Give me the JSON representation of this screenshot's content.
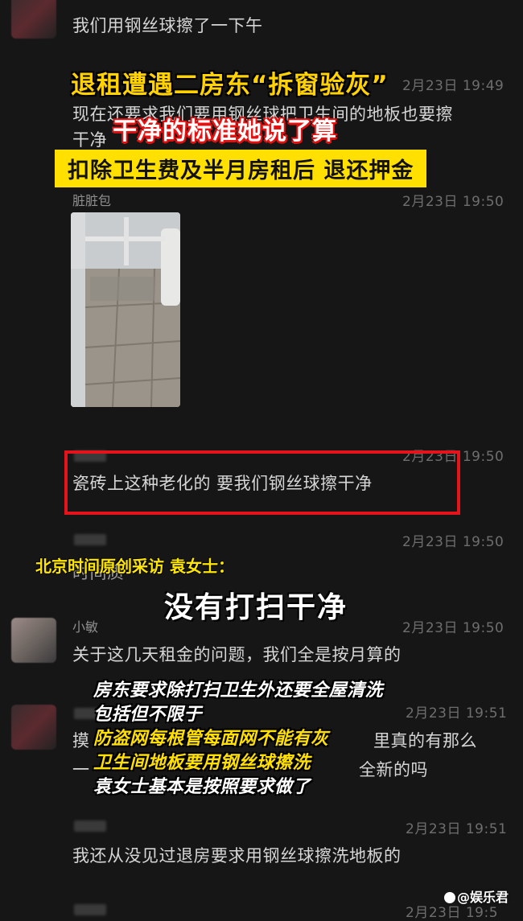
{
  "chat": {
    "top_msg": "我们用钢丝球擦了一下午",
    "msg2_time": "2月23日 19:49",
    "msg2_text_l1": "现在还要求我们要用钢丝球把卫生间的地板也要擦",
    "msg2_text_l2": "干净",
    "msg3_name": "脏脏包",
    "msg3_time": "2月23日 19:50",
    "msg4_time": "2月23日 19:50",
    "msg4_text": "瓷砖上这种老化的 要我们钢丝球擦干净",
    "msg5_time": "2月23日 19:50",
    "msg5_text": "时间质",
    "msg6_name": "小敏",
    "msg6_time": "2月23日 19:50",
    "msg6_text": "关于这几天租金的问题，我们全是按月算的",
    "msg7_time": "2月23日 19:51",
    "msg7_text_l1": "摸",
    "msg7_text_l1_right": "里真的有那么",
    "msg7_text_l2_left": "一",
    "msg7_text_l2_right": "全新的吗",
    "msg8_time": "2月23日 19:51",
    "msg8_text": "我还从没见过退房要求用钢丝球擦洗地板的",
    "msg9_time": "2月23日 19:5"
  },
  "overlay": {
    "headline": "退租遭遇二房东“拆窗验灰”",
    "red_line": "干净的标准她说了算",
    "yellow_bar": "扣除卫生费及半月房租后 退还押金",
    "interview_label": "北京时间原创采访  袁女士：",
    "quote": "没有打扫干净",
    "cap1": "房东要求除打扫卫生外还要全屋清洗",
    "cap2": "包括但不限于",
    "cap3": "防盗网每根管每面网不能有灰",
    "cap4": "卫生间地板要用钢丝球擦洗",
    "cap5": "袁女士基本是按照要求做了",
    "watermark": "@娱乐君"
  },
  "colors": {
    "background": "#161616",
    "highlight_yellow": "#ffe000",
    "alert_red": "#e3141b"
  }
}
